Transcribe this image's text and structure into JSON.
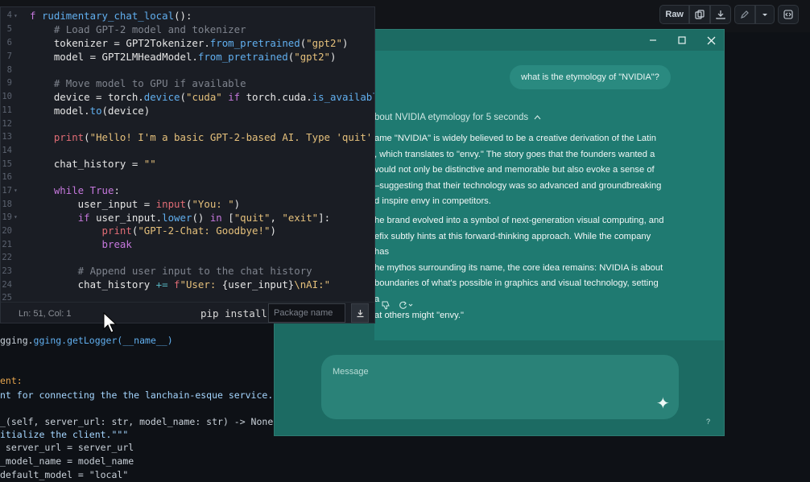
{
  "toolbar": {
    "raw_label": "Raw",
    "copy_icon": "copy-icon",
    "download_icon": "download-icon",
    "edit_icon": "pencil-icon",
    "more_icon": "chevron-down-icon",
    "symbols_icon": "code-square-icon"
  },
  "background_code": [
    "gging.getLogger(__name__)",
    "ent:",
    "nt for connecting the the lanchain-esque service.\"\"\"",
    "_(self, server_url: str, model_name: str) -> None:",
    "itialize the client.\"\"\"",
    " server_url = server_url",
    "_model_name = model_name",
    "default_model = \"local\""
  ],
  "editor": {
    "line_numbers": [
      "4",
      "5",
      "6",
      "7",
      "8",
      "9",
      "10",
      "11",
      "12",
      "13",
      "14",
      "15",
      "16",
      "17",
      "18",
      "19",
      "20",
      "21",
      "22",
      "23",
      "24",
      "25"
    ],
    "fold_lines": [
      "4",
      "17",
      "19"
    ],
    "status": "Ln: 51, Col: 1",
    "pip_label": "pip install",
    "pip_placeholder": "Package name"
  },
  "chat": {
    "user_message": "what is the etymology of \"NVIDIA\"?",
    "thought_label": "bout NVIDIA etymology for 5 seconds",
    "paragraph1": [
      "ame \"NVIDIA\" is widely believed to be a creative derivation of the Latin",
      ", which translates to \"envy.\" The story goes that the founders wanted a",
      "vould not only be distinctive and memorable but also evoke a sense of",
      "–suggesting that their technology was so advanced and groundbreaking",
      "d inspire envy in competitors."
    ],
    "paragraph2": [
      "he brand evolved into a symbol of next-generation visual computing, and",
      "efix subtly hints at this forward-thinking approach. While the company has",
      "he mythos surrounding its name, the core idea remains: NVIDIA is about",
      " boundaries of what's possible in graphics and visual technology, setting a",
      "at others might \"envy.\""
    ],
    "composer_placeholder": "Message",
    "help_label": "?"
  }
}
